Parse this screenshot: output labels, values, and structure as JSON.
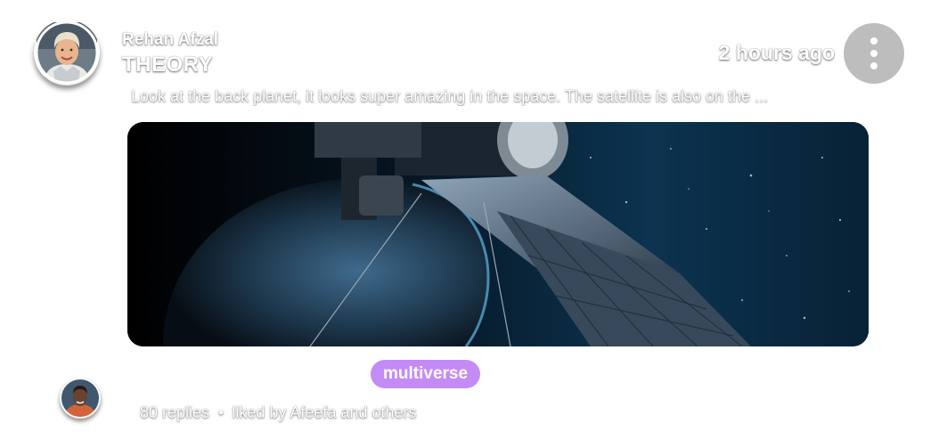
{
  "post": {
    "author": "Rehan Afzal",
    "category": "THEORY",
    "timestamp": "2 hours ago",
    "preview": "Look at the back planet, it looks super amazing in the space. The satellite is also on the ...",
    "tag": "multiverse",
    "replies": "80 replies",
    "separator": "•",
    "likes": "liked by Afeefa and others"
  },
  "colors": {
    "more_button": "#bdbdbd",
    "tag_bg": "#c58bf5"
  },
  "icons": {
    "more": "vertical-ellipsis-icon"
  }
}
